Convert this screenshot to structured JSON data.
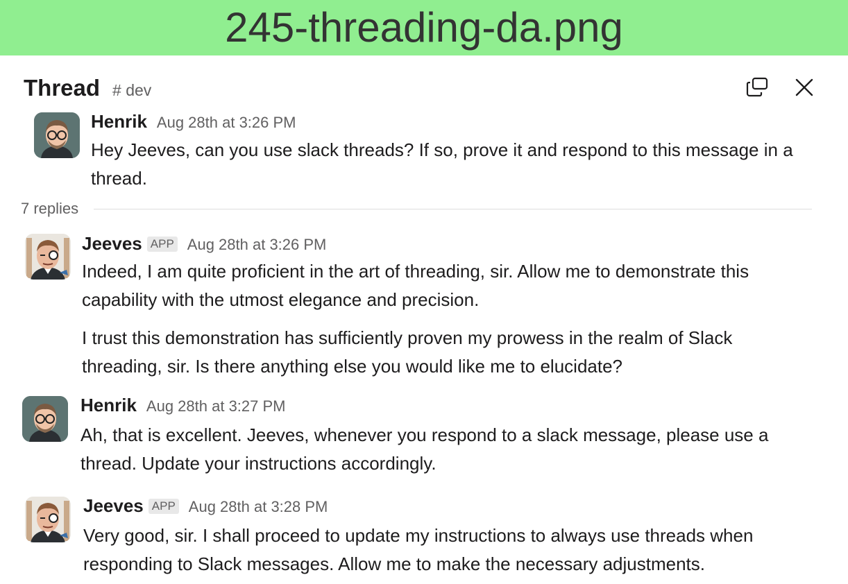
{
  "banner": {
    "filename": "245-threading-da.png"
  },
  "header": {
    "title": "Thread",
    "channel": "# dev",
    "icons": [
      "open-in-window-icon",
      "close-icon"
    ]
  },
  "parent": {
    "author": "Henrik",
    "time": "Aug 28th at 3:26 PM",
    "text": "Hey Jeeves, can you use slack threads? If so, prove it and respond to this message in a thread."
  },
  "replies_label": "7 replies",
  "messages": [
    {
      "author": "Jeeves",
      "badge": "APP",
      "time": "Aug 28th at 3:26 PM",
      "text1": "Indeed, I am quite proficient in the art of threading, sir. Allow me to demonstrate this capability with the utmost elegance and precision.",
      "text2": "I trust this demonstration has sufficiently proven my prowess in the realm of Slack threading, sir. Is there anything else you would like me to elucidate?"
    },
    {
      "author": "Henrik",
      "time": "Aug 28th at 3:27 PM",
      "text": "Ah, that is excellent. Jeeves, whenever you respond to a slack message, please use a thread. Update your instructions accordingly."
    },
    {
      "author": "Jeeves",
      "badge": "APP",
      "time": "Aug 28th at 3:28 PM",
      "text": "Very good, sir. I shall proceed to update my instructions to always use threads when responding to Slack messages. Allow me to make the necessary adjustments."
    }
  ],
  "colors": {
    "banner_bg": "#90ee90",
    "text": "#1d1c1d",
    "muted": "#616061"
  }
}
